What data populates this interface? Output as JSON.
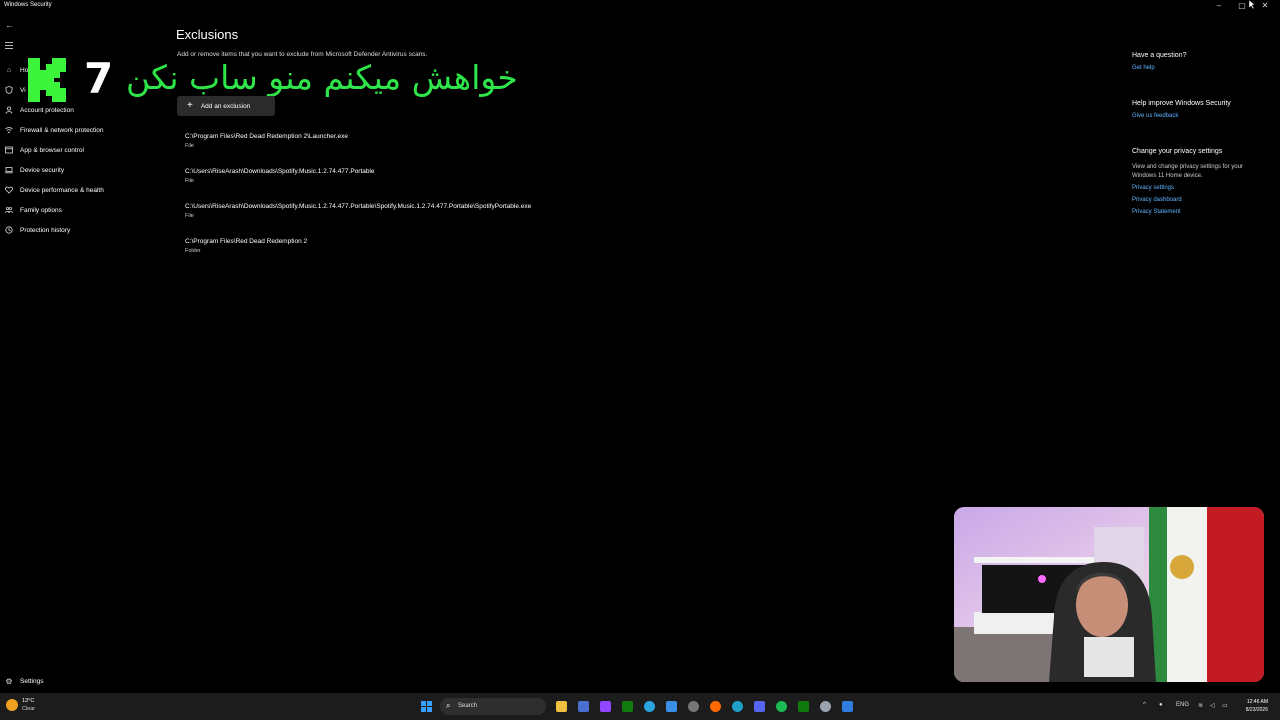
{
  "window": {
    "title": "Windows Security"
  },
  "overlay": {
    "number": "7",
    "text": "خواهش میکنم منو ساب نکن"
  },
  "nav": {
    "items": [
      {
        "label": "Ho",
        "icon": "home-icon"
      },
      {
        "label": "Vi",
        "icon": "shield-icon"
      },
      {
        "label": "Account protection",
        "icon": "person-icon"
      },
      {
        "label": "Firewall & network protection",
        "icon": "wifi-icon"
      },
      {
        "label": "App & browser control",
        "icon": "app-browser-icon"
      },
      {
        "label": "Device security",
        "icon": "laptop-icon"
      },
      {
        "label": "Device performance & health",
        "icon": "heart-icon"
      },
      {
        "label": "Family options",
        "icon": "family-icon"
      },
      {
        "label": "Protection history",
        "icon": "history-icon"
      }
    ],
    "settings_label": "Settings"
  },
  "main": {
    "title": "Exclusions",
    "subtitle": "Add or remove items that you want to exclude from Microsoft Defender Antivirus scans.",
    "add_button": "Add an exclusion",
    "exclusions": [
      {
        "path": "C:\\Program Files\\Red Dead Redemption 2\\Launcher.exe",
        "type": "File"
      },
      {
        "path": "C:\\Users\\RiseArash\\Downloads\\Spotify.Music.1.2.74.477.Portable",
        "type": "File"
      },
      {
        "path": "C:\\Users\\RiseArash\\Downloads\\Spotify.Music.1.2.74.477.Portable\\Spotify.Music.1.2.74.477.Portable\\SpotifyPortable.exe",
        "type": "File"
      },
      {
        "path": "C:\\Program Files\\Red Dead Redemption 2",
        "type": "Folder"
      }
    ]
  },
  "side": {
    "question": {
      "heading": "Have a question?",
      "link": "Get help"
    },
    "improve": {
      "heading": "Help improve Windows Security",
      "link": "Give us feedback"
    },
    "privacy": {
      "heading": "Change your privacy settings",
      "text": "View and change privacy settings for your Windows 11 Home device.",
      "links": [
        "Privacy settings",
        "Privacy dashboard",
        "Privacy Statement"
      ]
    }
  },
  "taskbar": {
    "weather": {
      "temp": "13°C",
      "condition": "Clear"
    },
    "search_label": "Search",
    "language": "ENG",
    "time": "12:46 AM",
    "date": "8/23/2026"
  }
}
